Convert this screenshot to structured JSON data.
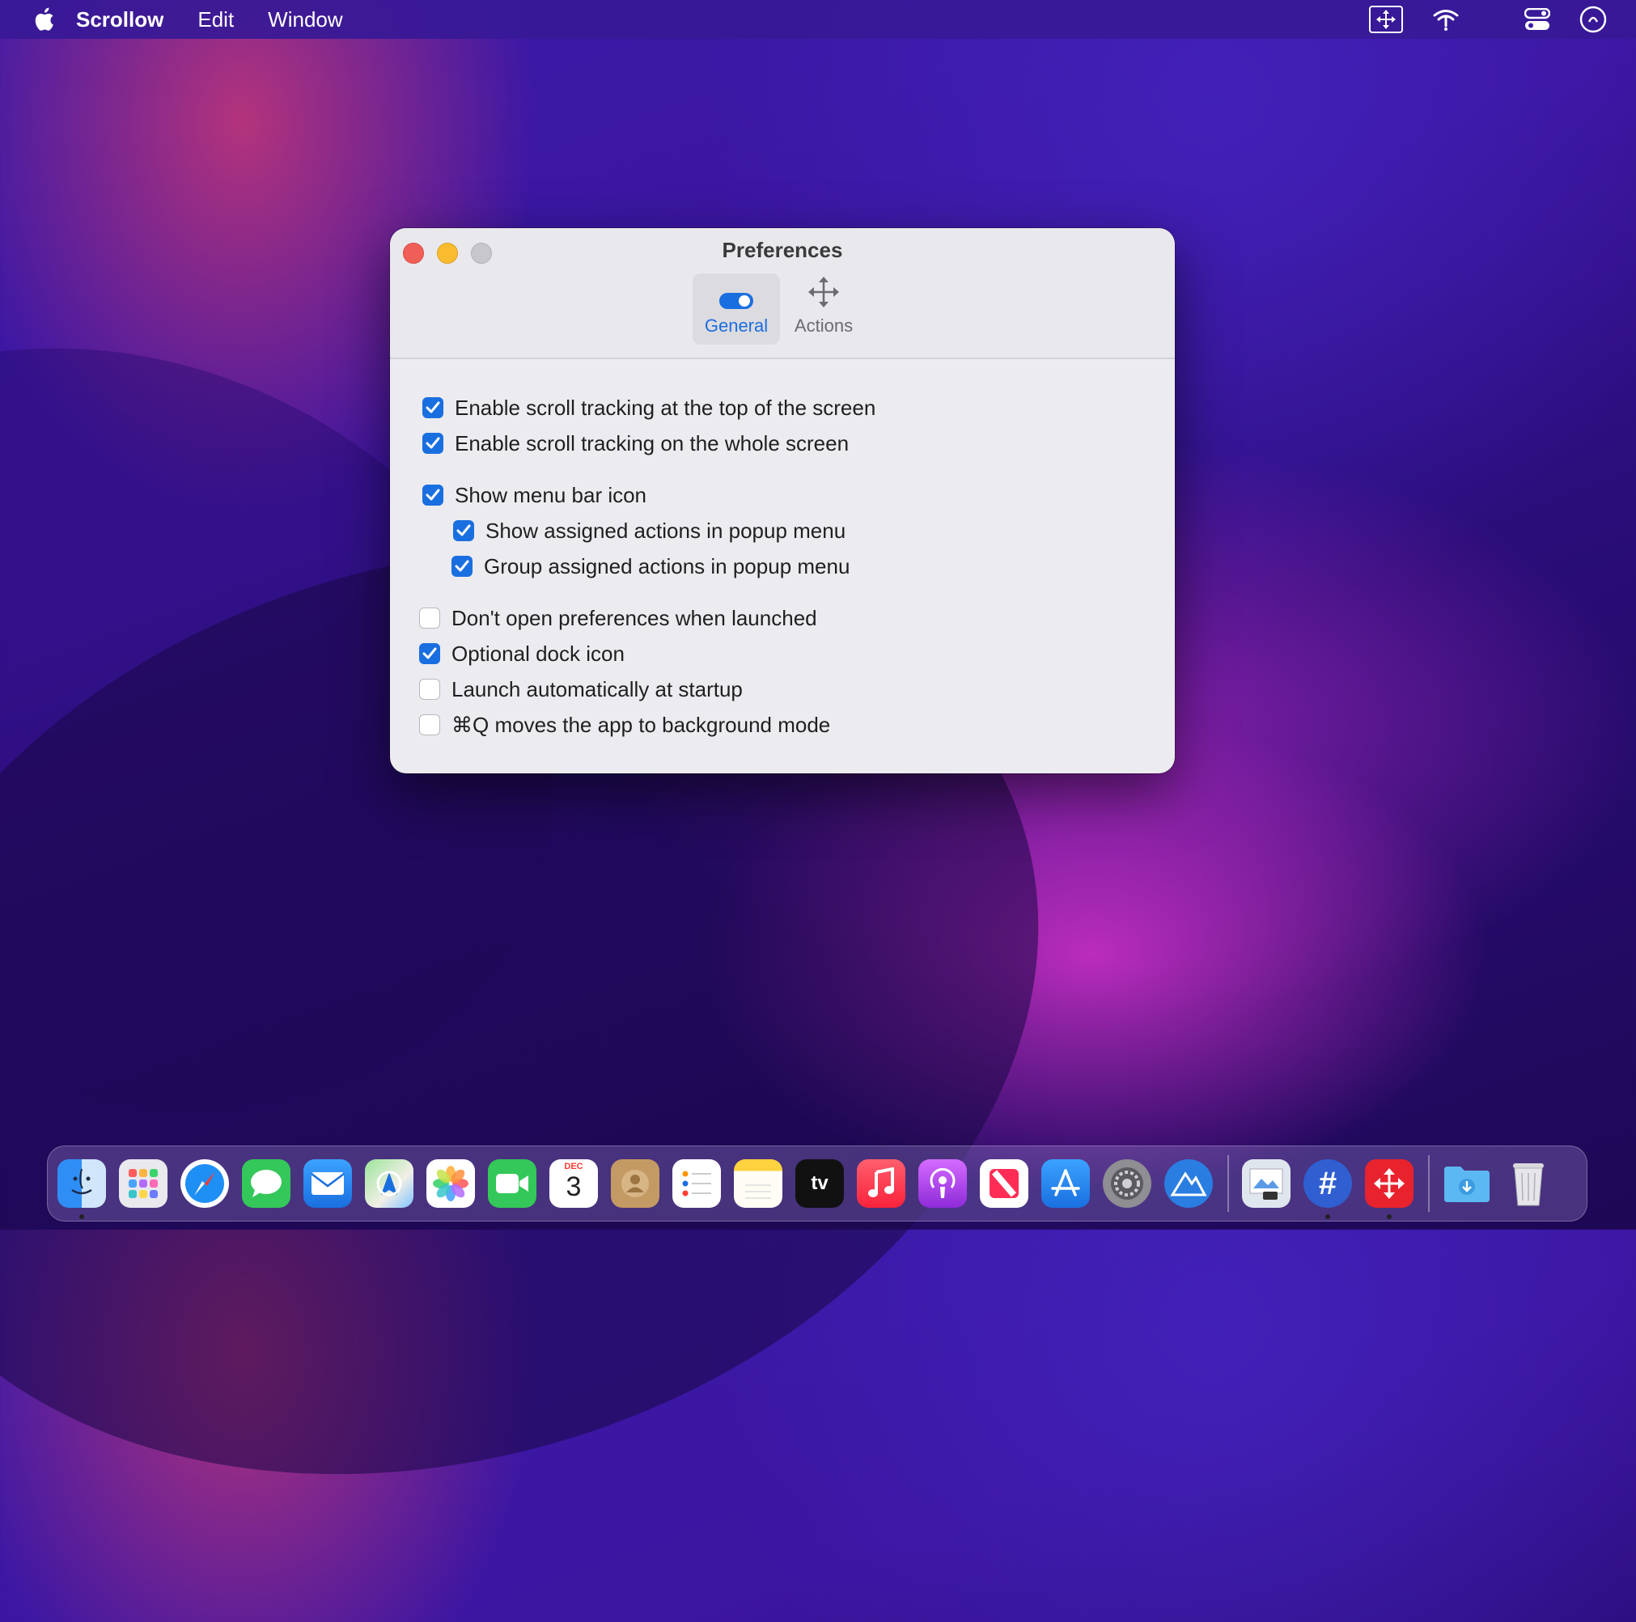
{
  "menubar": {
    "app_name": "Scrollow",
    "items": [
      "Edit",
      "Window"
    ],
    "right_icons": [
      "scrollow-status-icon",
      "wifi-icon",
      "control-center-icon",
      "siri-icon"
    ]
  },
  "window": {
    "title": "Preferences",
    "tabs": [
      {
        "label": "General",
        "icon": "toggle-icon",
        "active": true
      },
      {
        "label": "Actions",
        "icon": "move-arrows-icon",
        "active": false
      }
    ],
    "options": [
      {
        "label": "Enable scroll tracking at the top of the screen",
        "checked": true
      },
      {
        "label": "Enable scroll tracking on the whole screen",
        "checked": true
      },
      {
        "label": "Show menu bar icon",
        "checked": true
      },
      {
        "label": "Show assigned actions in popup menu",
        "checked": true
      },
      {
        "label": "Group assigned actions in popup menu",
        "checked": true
      },
      {
        "label": "Don't open preferences when launched",
        "checked": false
      },
      {
        "label": "Optional dock icon",
        "checked": true
      },
      {
        "label": "Launch automatically at startup",
        "checked": false
      },
      {
        "label": "⌘Q moves the app to background mode",
        "checked": false
      }
    ]
  },
  "dock": {
    "calendar_month": "DEC",
    "calendar_day": "3",
    "tv_label": "tv",
    "apps": [
      "finder",
      "launchpad",
      "safari",
      "messages",
      "mail",
      "maps",
      "photos",
      "facetime",
      "calendar",
      "contacts",
      "reminders",
      "notes",
      "apple-tv",
      "music",
      "podcasts",
      "news",
      "app-store",
      "system-preferences",
      "altimeter",
      "preview",
      "hashtag",
      "scrollow",
      "downloads",
      "trash"
    ]
  },
  "colors": {
    "accent": "#1a6fe0",
    "close": "#f05f57",
    "minimize": "#f8bc2e",
    "zoom": "#c8c7cb"
  }
}
